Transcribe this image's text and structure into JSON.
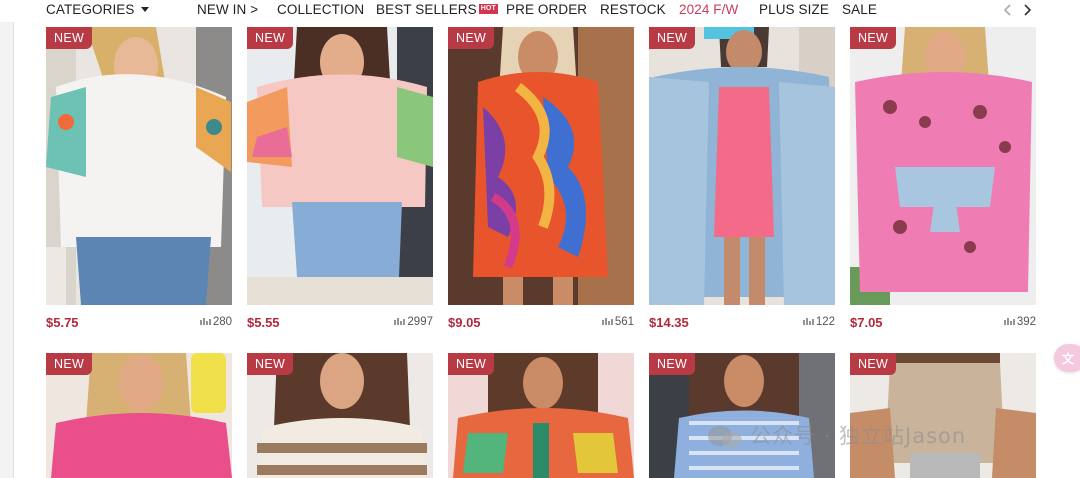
{
  "nav": {
    "categories": "CATEGORIES",
    "new_in": "NEW IN >",
    "collection": "COLLECTION",
    "best_sellers": "BEST SELLERS",
    "hot_badge": "HOT",
    "pre_order": "PRE ORDER",
    "restock": "RESTOCK",
    "season": "2024 F/W",
    "plus_size": "PLUS SIZE",
    "sale": "SALE",
    "prev_icon": "chevron-left-icon",
    "next_icon": "chevron-right-icon"
  },
  "colors": {
    "accent": "#c93d5a",
    "badge": "#b73a45",
    "price": "#b3283a"
  },
  "products_row1": [
    {
      "badge": "NEW",
      "price": "$5.75",
      "sold": "280",
      "image": "white top with crochet sleeves"
    },
    {
      "badge": "NEW",
      "price": "$5.55",
      "sold": "2997",
      "image": "pink colorblock tee"
    },
    {
      "badge": "NEW",
      "price": "$9.05",
      "sold": "561",
      "image": "multicolor print mini dress"
    },
    {
      "badge": "NEW",
      "price": "$14.35",
      "sold": "122",
      "image": "denim jacket over pink romper"
    },
    {
      "badge": "NEW",
      "price": "$7.05",
      "sold": "392",
      "image": "pink leopard tee dress"
    }
  ],
  "products_row2": [
    {
      "badge": "NEW",
      "image": "hot pink ribbed top"
    },
    {
      "badge": "NEW",
      "image": "striped knit sweater"
    },
    {
      "badge": "NEW",
      "image": "aztec print shirt"
    },
    {
      "badge": "NEW",
      "image": "blue stripe tie-front top"
    },
    {
      "badge": "NEW",
      "image": "beige tank with shorts"
    }
  ],
  "floating": {
    "lang_icon": "translate-icon",
    "lang_label": "文"
  },
  "watermark": "公众号 · 独立站Jason"
}
